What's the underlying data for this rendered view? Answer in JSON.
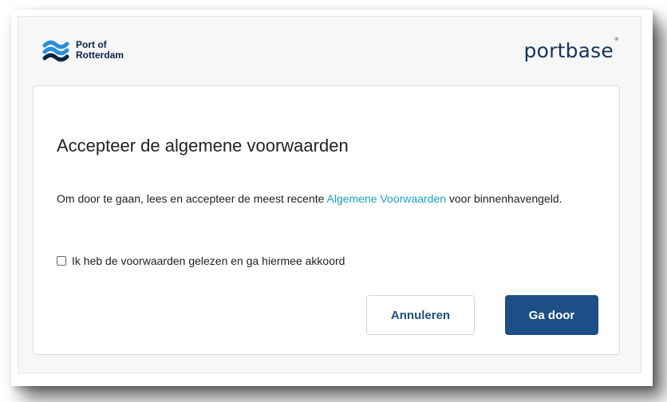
{
  "header": {
    "left_logo": {
      "line1": "Port of",
      "line2": "Rotterdam",
      "icon": "waves-logo-icon"
    },
    "right_logo": {
      "text_before": "p",
      "text_o": "o",
      "text_after": "rtbase",
      "registered": "®"
    }
  },
  "dialog": {
    "title": "Accepteer de algemene voorwaarden",
    "description_before": "Om door te gaan, lees en accepteer de meest recente ",
    "terms_link": "Algemene Voorwaarden",
    "description_after": " voor binnenhavengeld.",
    "checkbox_label": "Ik heb de voorwaarden gelezen en ga hiermee akkoord",
    "checkbox_checked": false,
    "cancel_label": "Annuleren",
    "continue_label": "Ga door"
  },
  "colors": {
    "primary": "#1d4f86",
    "link": "#1aa1c6",
    "logo_navy": "#17345a",
    "logo_blue": "#2a8fd8"
  }
}
